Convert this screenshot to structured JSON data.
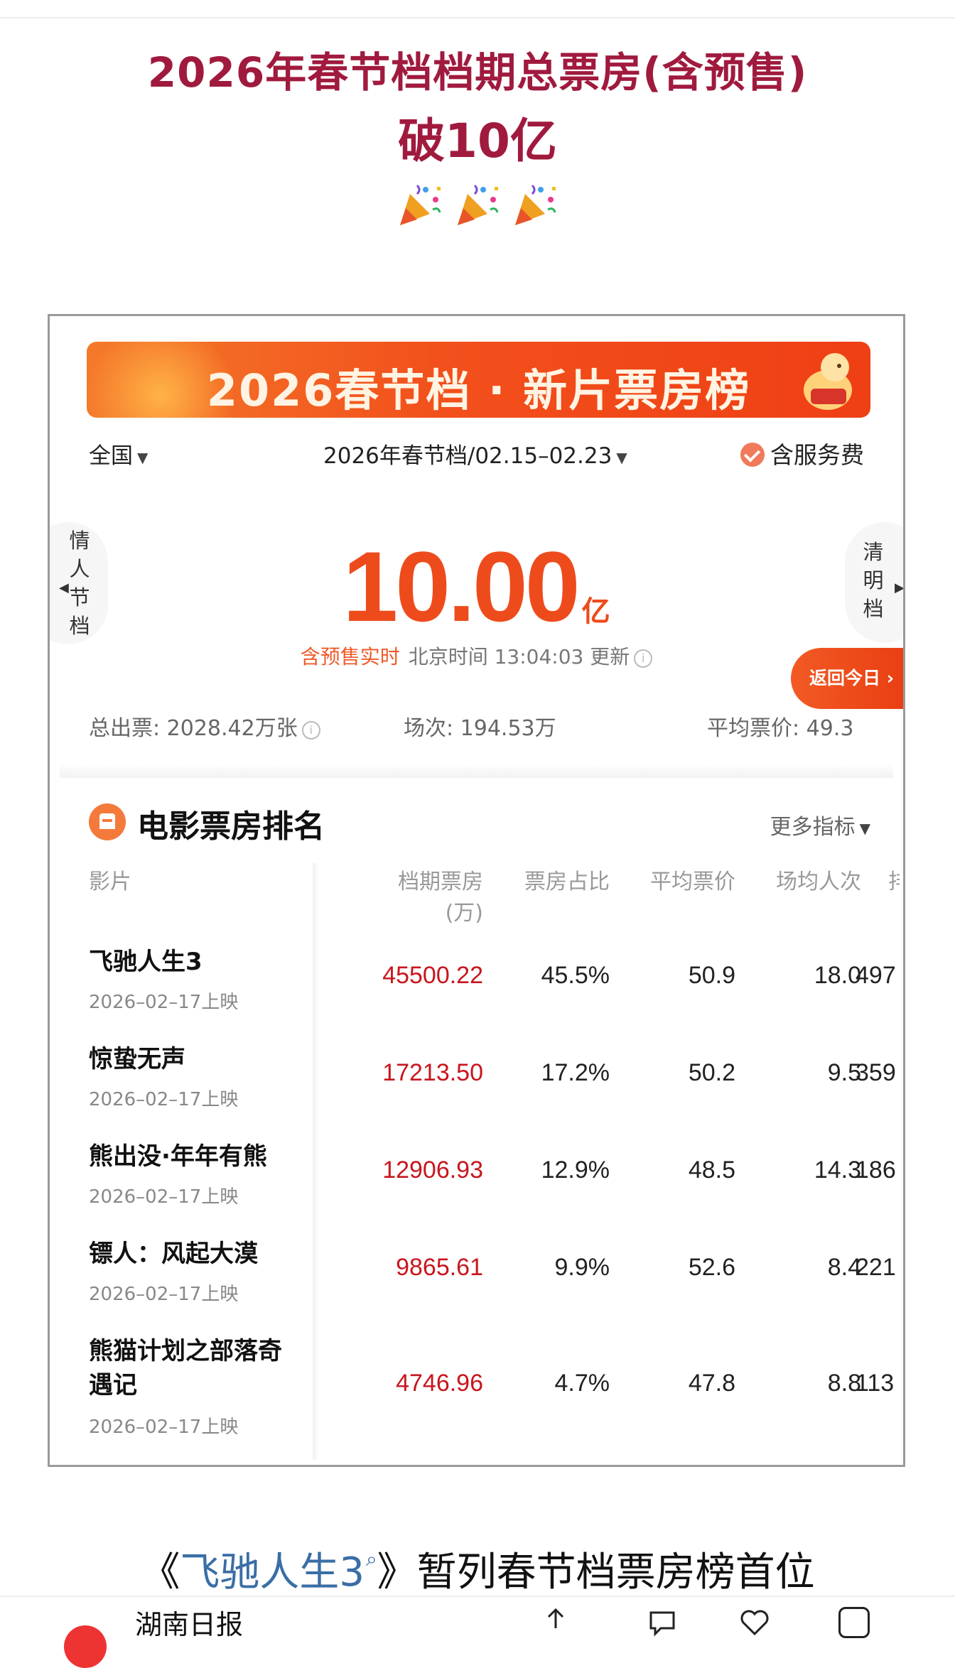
{
  "headline": {
    "line1": "2026年春节档档期总票房(含预售)",
    "line2": "破10亿",
    "emoji": [
      "party-popper-icon",
      "party-popper-icon",
      "party-popper-icon"
    ]
  },
  "screenshot": {
    "banner": "2026春节档 · 新片票房榜",
    "filter": {
      "region": "全国",
      "period": "2026年春节档/02.15–02.23",
      "service_fee": "含服务费"
    },
    "prev_tab": "情人节档",
    "next_tab": "清明档",
    "total": {
      "value": "10.00",
      "unit": "亿"
    },
    "update": {
      "live": "含预售实时",
      "time": "北京时间 13:04:03 更新"
    },
    "back_today": "返回今日 ›",
    "stats": {
      "tickets": "总出票: 2028.42万张",
      "shows": "场次: 194.53万",
      "avg_price": "平均票价: 49.3"
    },
    "ranking": {
      "title": "电影票房排名",
      "more": "更多指标",
      "columns": {
        "film": "影片",
        "box": "档期票房",
        "box_unit": "(万)",
        "share": "票房占比",
        "price": "平均票价",
        "people": "场均人次",
        "extra": "排"
      },
      "rows": [
        {
          "name": "飞驰人生3",
          "date": "2026–02–17上映",
          "box": "45500.22",
          "share": "45.5%",
          "price": "50.9",
          "people": "18.0",
          "extra": "497"
        },
        {
          "name": "惊蛰无声",
          "date": "2026–02–17上映",
          "box": "17213.50",
          "share": "17.2%",
          "price": "50.2",
          "people": "9.5",
          "extra": "359"
        },
        {
          "name": "熊出没·年年有熊",
          "date": "2026–02–17上映",
          "box": "12906.93",
          "share": "12.9%",
          "price": "48.5",
          "people": "14.3",
          "extra": "186"
        },
        {
          "name": "镖人：风起大漠",
          "date": "2026–02–17上映",
          "box": "9865.61",
          "share": "9.9%",
          "price": "52.6",
          "people": "8.4",
          "extra": "221"
        },
        {
          "name": "熊猫计划之部落奇遇记",
          "date": "2026–02–17上映",
          "box": "4746.96",
          "share": "4.7%",
          "price": "47.8",
          "people": "8.8",
          "extra": "113"
        }
      ]
    }
  },
  "caption": {
    "open": "《",
    "film_link": "飞驰人生3",
    "close_and_text": "》暂列春节档票房榜首位"
  },
  "bottom_bar": {
    "name": "湖南日报"
  },
  "colors": {
    "headline": "#a01a3e",
    "accent": "#ee4b1c",
    "box_value": "#c8161e",
    "link": "#3a6ea5"
  }
}
